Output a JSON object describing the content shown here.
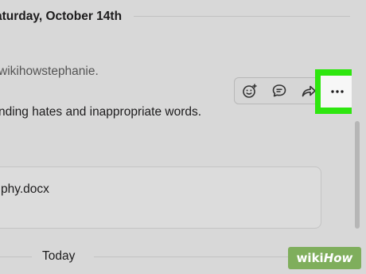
{
  "header": {
    "date_label": "aturday, October 14th"
  },
  "message": {
    "joined_text": "wikihowstephanie.",
    "body_text": "nding hates and inappropriate words."
  },
  "actions": {
    "icons": [
      "add-reaction-icon",
      "reply-thread-icon",
      "share-icon",
      "more-actions-icon"
    ]
  },
  "file": {
    "name": "phy.docx"
  },
  "divider": {
    "today_label": "Today"
  },
  "watermark": {
    "wiki": "wiki",
    "how": "How"
  },
  "colors": {
    "highlight": "#2ee60f",
    "background": "#d8d8d8"
  }
}
